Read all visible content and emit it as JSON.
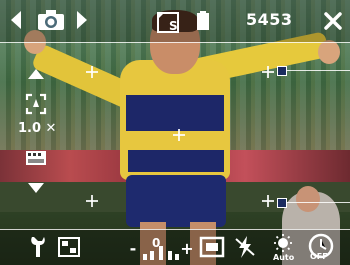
{
  "status": {
    "shots_remaining": "5453"
  },
  "side_panel": {
    "zoom_level": "1.0 ✕"
  },
  "toolbar": {
    "exposure_value": "0",
    "minus": "-",
    "plus": "+"
  },
  "icons": {
    "prev": "chevron-left-icon",
    "camera_mode": "camera-icon",
    "next": "chevron-right-icon",
    "storage": "sd-card-icon",
    "battery": "battery-icon",
    "close": "close-icon",
    "zoom_in": "triangle-up-icon",
    "zoom_out": "triangle-down-icon",
    "focus_mode": "focus-frame-icon",
    "film_mode": "film-icon",
    "tools": "wrench-icon",
    "scene_mode": "scene-icon",
    "frame_mode": "frame-icon",
    "flash": "flash-off-icon",
    "white_balance": "white-balance-auto-icon",
    "timer": "timer-off-icon"
  },
  "colors": {
    "jersey_yellow": "#e7c73f",
    "jersey_blue": "#1d2768",
    "marker_blue": "#1a2b5f"
  }
}
